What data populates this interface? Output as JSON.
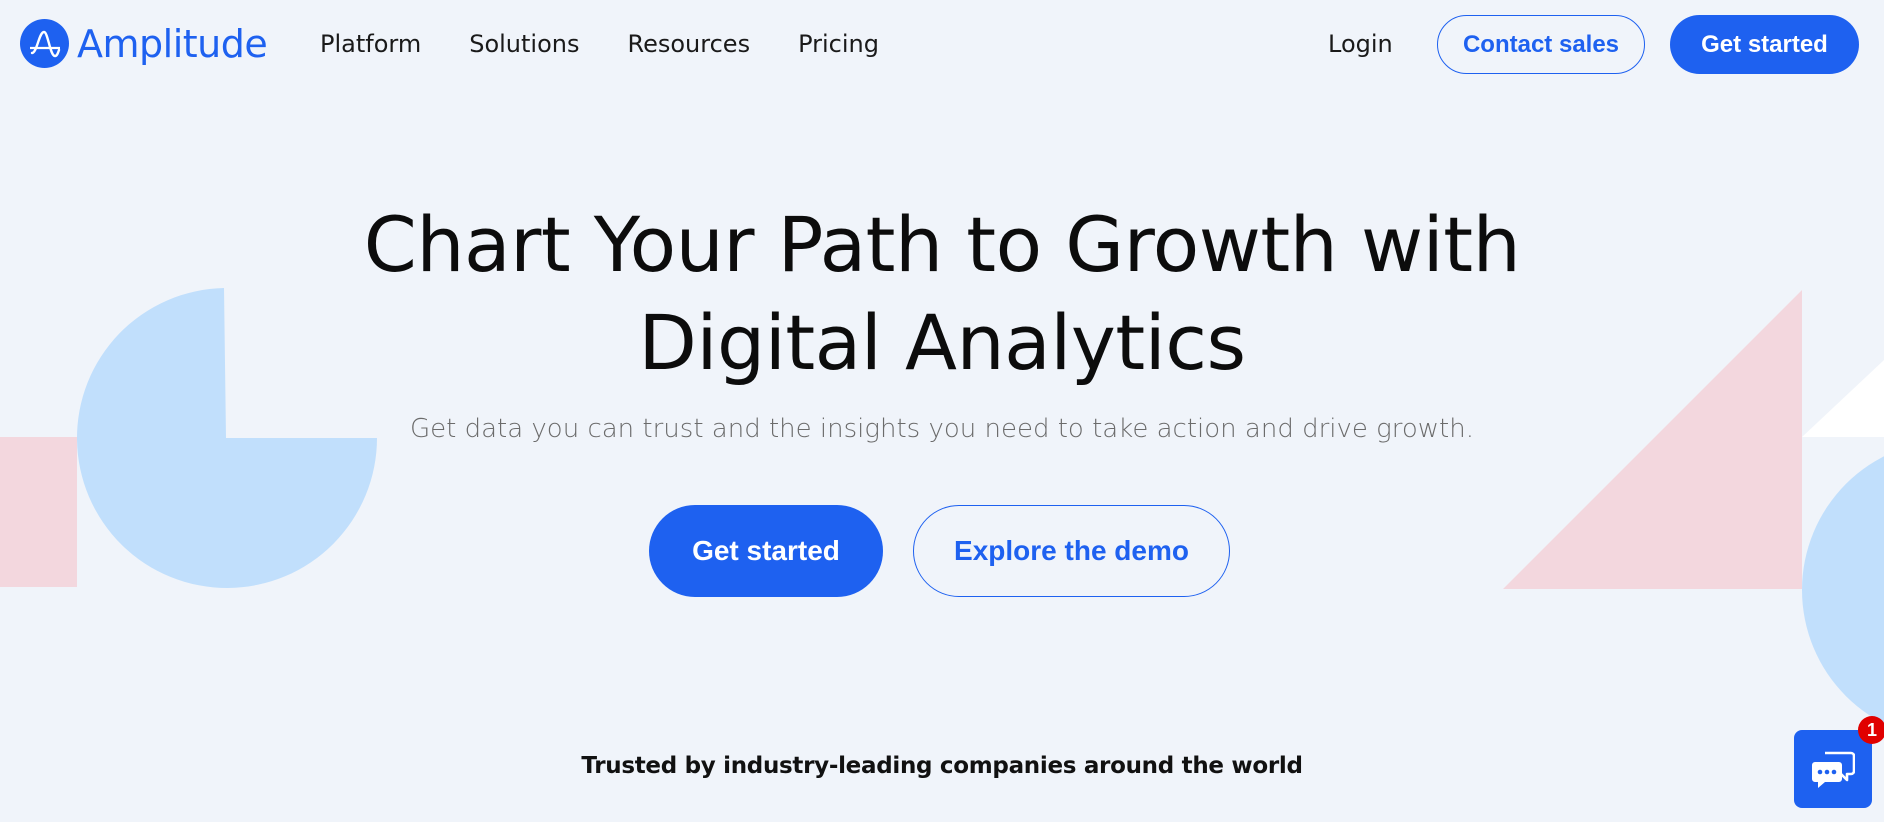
{
  "brand": {
    "name": "Amplitude",
    "logo_icon": "amplitude-wave-icon",
    "accent_color": "#1e61f0"
  },
  "nav": {
    "items": [
      {
        "label": "Platform"
      },
      {
        "label": "Solutions"
      },
      {
        "label": "Resources"
      },
      {
        "label": "Pricing"
      }
    ],
    "login_label": "Login",
    "contact_label": "Contact sales",
    "get_started_label": "Get started"
  },
  "hero": {
    "title_line1": "Chart Your Path to Growth with",
    "title_line2": "Digital Analytics",
    "subtitle": "Get data you can trust and the insights you need to take action and drive growth.",
    "primary_cta": "Get started",
    "secondary_cta": "Explore the demo"
  },
  "trusted": {
    "text": "Trusted by industry-leading companies around the world"
  },
  "chat_widget": {
    "icon": "chat-bubbles-icon",
    "badge_count": "1"
  },
  "colors": {
    "background": "#f0f4fa",
    "shape_blue": "#c1dffc",
    "shape_pink": "#f3d7de",
    "badge_red": "#e00000"
  }
}
